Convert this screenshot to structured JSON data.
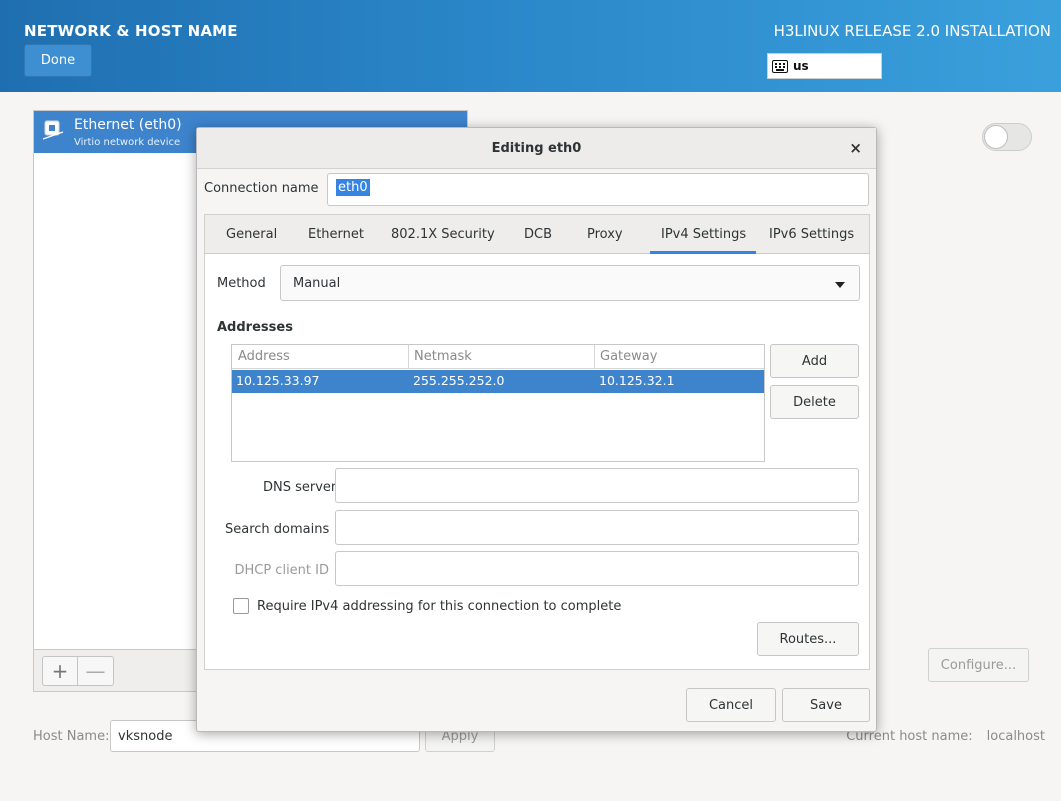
{
  "header": {
    "title": "NETWORK & HOST NAME",
    "done_label": "Done",
    "product": "H3LINUX RELEASE 2.0 INSTALLATION",
    "keyboard_layout": "us"
  },
  "devices": {
    "items": [
      {
        "name": "Ethernet (eth0)",
        "description": "Virtio network device"
      }
    ],
    "add_label": "+",
    "remove_label": "—"
  },
  "device_panel": {
    "configure_label": "Configure...",
    "toggle_on": false
  },
  "hostname": {
    "label": "Host Name:",
    "value": "vksnode",
    "apply_label": "Apply",
    "current_label": "Current host name:",
    "current_value": "localhost"
  },
  "dialog": {
    "title": "Editing eth0",
    "close_glyph": "×",
    "connection_name_label": "Connection name",
    "connection_name_value": "eth0",
    "tabs": [
      "General",
      "Ethernet",
      "802.1X Security",
      "DCB",
      "Proxy",
      "IPv4 Settings",
      "IPv6 Settings"
    ],
    "active_tab": "IPv4 Settings",
    "method_label": "Method",
    "method_value": "Manual",
    "addresses_heading": "Addresses",
    "address_columns": [
      "Address",
      "Netmask",
      "Gateway"
    ],
    "address_rows": [
      [
        "10.125.33.97",
        "255.255.252.0",
        "10.125.32.1"
      ]
    ],
    "add_label": "Add",
    "delete_label": "Delete",
    "dns_label": "DNS servers",
    "dns_value": "",
    "search_label": "Search domains",
    "search_value": "",
    "dhcp_label": "DHCP client ID",
    "dhcp_value": "",
    "require_label": "Require IPv4 addressing for this connection to complete",
    "require_checked": false,
    "routes_label": "Routes...",
    "cancel_label": "Cancel",
    "save_label": "Save"
  },
  "colors": {
    "header_gradient_start": "#1f6fb0",
    "header_gradient_end": "#3aa0dc",
    "selection": "#3d84cd",
    "tab_accent": "#3584e4"
  }
}
